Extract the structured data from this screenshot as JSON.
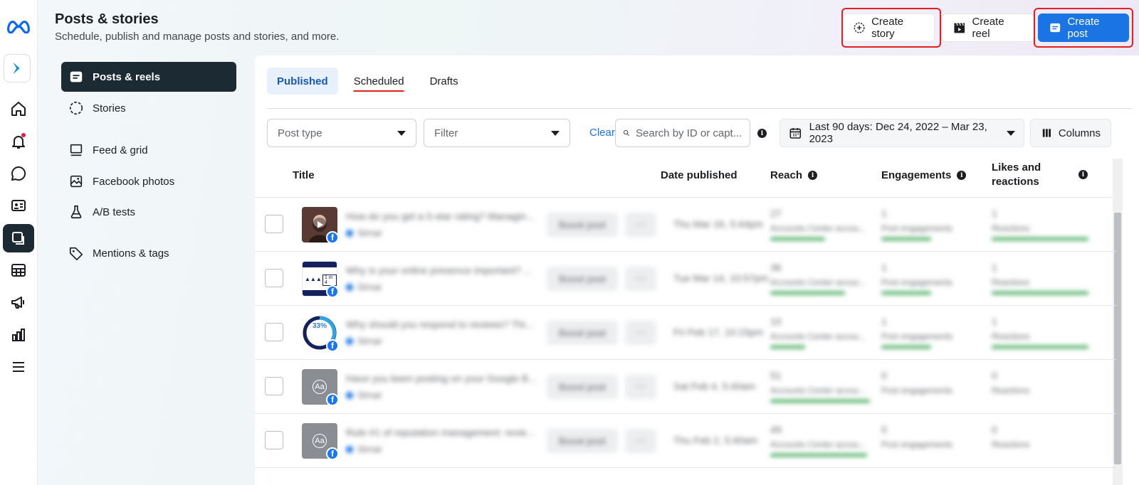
{
  "header": {
    "title": "Posts & stories",
    "subtitle": "Schedule, publish and manage posts and stories, and more.",
    "create_story": "Create story",
    "create_reel": "Create reel",
    "create_post": "Create post"
  },
  "rail": {
    "items": [
      "meta-logo-icon",
      "app-icon",
      "home-icon",
      "bell-icon",
      "chat-icon",
      "contact-card-icon",
      "posts-icon",
      "table-icon",
      "megaphone-icon",
      "bar-chart-icon",
      "menu-icon"
    ]
  },
  "subnav": {
    "items": [
      {
        "label": "Posts & reels",
        "icon": "posts-icon"
      },
      {
        "label": "Stories",
        "icon": "story-icon"
      },
      {
        "label": "Feed & grid",
        "icon": "feed-icon"
      },
      {
        "label": "Facebook photos",
        "icon": "photos-icon"
      },
      {
        "label": "A/B tests",
        "icon": "flask-icon"
      },
      {
        "label": "Mentions & tags",
        "icon": "tag-icon"
      }
    ]
  },
  "tabs": [
    "Published",
    "Scheduled",
    "Drafts"
  ],
  "filters": {
    "post_type": "Post type",
    "filter": "Filter",
    "clear": "Clear",
    "search_placeholder": "Search by ID or capt...",
    "date_range": "Last 90 days: Dec 24, 2022 – Mar 23, 2023",
    "columns": "Columns"
  },
  "table": {
    "headers": {
      "title": "Title",
      "date_published": "Date published",
      "reach": "Reach",
      "engagements": "Engagements",
      "likes_line1": "Likes and",
      "likes_line2": "reactions"
    },
    "rows": [
      {
        "title": "How do you get a 5-star rating? Managin...",
        "author": "Sirnar",
        "boost": "Boost post",
        "date": "Thu Mar 16, 5:44pm",
        "reach": "27",
        "reach_label": "Accounts Center accou...",
        "eng": "1",
        "eng_label": "Post engagements",
        "likes": "1",
        "likes_label": "Reactions",
        "reach_fill": 0.55,
        "eng_fill": 0.5,
        "likes_fill": 0.9
      },
      {
        "title": "Why is your online presence important? ...",
        "author": "Sirnar",
        "boost": "Boost post",
        "date": "Tue Mar 14, 10:57pm",
        "reach": "36",
        "reach_label": "Accounts Center accou...",
        "eng": "1",
        "eng_label": "Post engagements",
        "likes": "1",
        "likes_label": "Reactions",
        "reach_fill": 0.75,
        "eng_fill": 0.5,
        "likes_fill": 0.9
      },
      {
        "title": "Why should you respond to reviews? Thi...",
        "author": "Sirnar",
        "boost": "Boost post",
        "date": "Fri Feb 17, 10:15pm",
        "reach": "10",
        "reach_label": "Accounts Center accou...",
        "eng": "1",
        "eng_label": "Post engagements",
        "likes": "1",
        "likes_label": "Reactions",
        "reach_fill": 0.35,
        "eng_fill": 0.5,
        "likes_fill": 0.9
      },
      {
        "title": "Have you been posting on your Google B...",
        "author": "Sirnar",
        "boost": "Boost post",
        "date": "Sat Feb 4, 5:40am",
        "reach": "51",
        "reach_label": "Accounts Center accou...",
        "eng": "0",
        "eng_label": "Post engagements",
        "likes": "0",
        "likes_label": "Reactions",
        "reach_fill": 1.0,
        "eng_fill": 0,
        "likes_fill": 0
      },
      {
        "title": "Rule #1 of reputation management: revie...",
        "author": "Sirnar",
        "boost": "Boost post",
        "date": "Thu Feb 2, 5:40am",
        "reach": "49",
        "reach_label": "Accounts Center accou...",
        "eng": "0",
        "eng_label": "Post engagements",
        "likes": "0",
        "likes_label": "Reactions",
        "reach_fill": 0.97,
        "eng_fill": 0,
        "likes_fill": 0
      }
    ]
  },
  "thumbs": {
    "row2_text": "1 in 4",
    "row3_text": "33%",
    "placeholder_text": "Aa"
  },
  "colors": {
    "accent": "#1b74e4",
    "dark_nav": "#1c2b33",
    "highlight": "#e41e25",
    "progress": "#31a24c"
  }
}
